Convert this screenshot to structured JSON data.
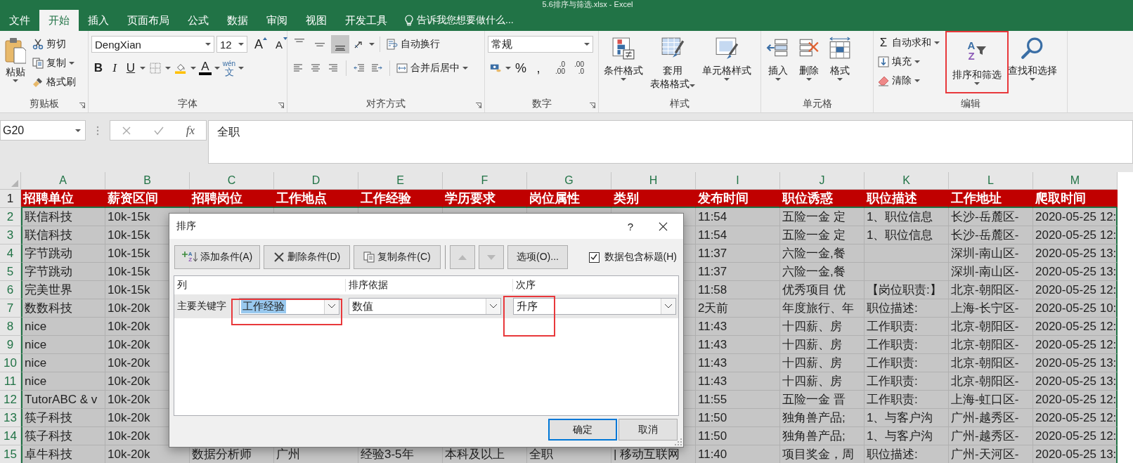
{
  "window": {
    "title": "5.6排序与筛选.xlsx - Excel"
  },
  "tabs": [
    {
      "label": "文件",
      "selected": false
    },
    {
      "label": "开始",
      "selected": true
    },
    {
      "label": "插入",
      "selected": false
    },
    {
      "label": "页面布局",
      "selected": false
    },
    {
      "label": "公式",
      "selected": false
    },
    {
      "label": "数据",
      "selected": false
    },
    {
      "label": "审阅",
      "selected": false
    },
    {
      "label": "视图",
      "selected": false
    },
    {
      "label": "开发工具",
      "selected": false
    }
  ],
  "tell_me": "告诉我您想要做什么...",
  "clipboard": {
    "paste": "粘贴",
    "cut": "剪切",
    "copy": "复制",
    "format_painter": "格式刷",
    "label": "剪贴板"
  },
  "font": {
    "name": "DengXian",
    "size": "12",
    "grow": "A",
    "shrink": "A",
    "bold": "B",
    "italic": "I",
    "underline": "U",
    "font_color": "A",
    "phonetic": [
      "wén",
      "文"
    ],
    "label": "字体"
  },
  "alignment": {
    "vertical": [
      {
        "selected": false
      },
      {
        "selected": false
      },
      {
        "selected": true
      }
    ],
    "wrap": "自动换行",
    "merge": "合并后居中",
    "label": "对齐方式"
  },
  "number": {
    "format": "常规",
    "percent": "%",
    "comma": ",",
    "increase_decimal": [
      ".0",
      ".00"
    ],
    "decrease_decimal": [
      ".00",
      ".0"
    ],
    "label": "数字"
  },
  "styles": {
    "conditional": "条件格式",
    "table": [
      "套用",
      "表格格式"
    ],
    "cell_styles": "单元格样式",
    "label": "样式"
  },
  "cells": {
    "insert": "插入",
    "delete": "删除",
    "format": "格式",
    "label": "单元格"
  },
  "editing": {
    "autosum_symbol": "Σ",
    "autosum": "自动求和",
    "fill": "填充",
    "clear": "清除",
    "sort_letters": [
      "A",
      "Z"
    ],
    "sort_filter": "排序和筛选",
    "sort_annotated": true,
    "find": "查找和选择",
    "label": "编辑"
  },
  "formula_bar": {
    "name_box": "G20",
    "function_label": "fx",
    "formula": "全职"
  },
  "grid": {
    "columns": [
      {
        "letter": "A",
        "selected": true
      },
      {
        "letter": "B",
        "selected": true
      },
      {
        "letter": "C",
        "selected": true
      },
      {
        "letter": "D",
        "selected": true
      },
      {
        "letter": "E",
        "selected": true
      },
      {
        "letter": "F",
        "selected": true
      },
      {
        "letter": "G",
        "selected": true
      },
      {
        "letter": "H",
        "selected": true
      },
      {
        "letter": "I",
        "selected": true
      },
      {
        "letter": "J",
        "selected": true
      },
      {
        "letter": "K",
        "selected": true
      },
      {
        "letter": "L",
        "selected": true
      },
      {
        "letter": "M",
        "selected": true
      }
    ],
    "header": {
      "number": "1",
      "selected": false,
      "cells": [
        "招聘单位",
        "薪资区间",
        "招聘岗位",
        "工作地点",
        "工作经验",
        "学历要求",
        "岗位属性",
        "类别",
        "发布时间",
        "职位诱惑",
        "职位描述",
        "工作地址",
        "爬取时间"
      ]
    },
    "rows": [
      {
        "number": "2",
        "selected": true,
        "left": [
          "联信科技",
          "10k-15k"
        ],
        "right": [
          "11:54",
          "五险一金 定",
          "1、职位信息",
          "长沙-岳麓区-",
          "2020-05-25 12:"
        ]
      },
      {
        "number": "3",
        "selected": true,
        "left": [
          "联信科技",
          "10k-15k"
        ],
        "right": [
          "11:54",
          "五险一金 定",
          "1、职位信息",
          "长沙-岳麓区-",
          "2020-05-25 12:"
        ]
      },
      {
        "number": "4",
        "selected": true,
        "left": [
          "字节跳动",
          "10k-15k"
        ],
        "right": [
          "11:37",
          "六险一金,餐",
          {
            "kind": "blank"
          },
          "深圳-南山区-",
          "2020-05-25 13:"
        ]
      },
      {
        "number": "5",
        "selected": true,
        "left": [
          "字节跳动",
          "10k-15k"
        ],
        "right": [
          "11:37",
          "六险一金,餐",
          {
            "kind": "blank"
          },
          "深圳-南山区-",
          "2020-05-25 13:"
        ]
      },
      {
        "number": "6",
        "selected": true,
        "left": [
          "完美世界",
          "10k-15k"
        ],
        "right": [
          "11:58",
          "优秀项目 优",
          "【岗位职责:】",
          "北京-朝阳区-",
          "2020-05-25 12:"
        ]
      },
      {
        "number": "7",
        "selected": true,
        "left": [
          "数数科技",
          "10k-20k"
        ],
        "right": [
          "2天前",
          "年度旅行、年",
          "职位描述:",
          "上海-长宁区-",
          "2020-05-25 10:"
        ]
      },
      {
        "number": "8",
        "selected": true,
        "left": [
          "nice",
          "10k-20k"
        ],
        "right": [
          "11:43",
          "十四薪、房",
          "工作职责:",
          "北京-朝阳区-",
          "2020-05-25 12:"
        ]
      },
      {
        "number": "9",
        "selected": true,
        "left": [
          "nice",
          "10k-20k"
        ],
        "right": [
          "11:43",
          "十四薪、房",
          "工作职责:",
          "北京-朝阳区-",
          "2020-05-25 12:"
        ]
      },
      {
        "number": "10",
        "selected": true,
        "left": [
          "nice",
          "10k-20k"
        ],
        "right": [
          "11:43",
          "十四薪、房",
          "工作职责:",
          "北京-朝阳区-",
          "2020-05-25 13:"
        ]
      },
      {
        "number": "11",
        "selected": true,
        "left": [
          "nice",
          "10k-20k"
        ],
        "right": [
          "11:43",
          "十四薪、房",
          "工作职责:",
          "北京-朝阳区-",
          "2020-05-25 13:"
        ]
      },
      {
        "number": "12",
        "selected": true,
        "left": [
          "TutorABC & v",
          "10k-20k"
        ],
        "right": [
          "11:55",
          "五险一金 晋",
          "工作职责:",
          "上海-虹口区-",
          "2020-05-25 12:"
        ]
      },
      {
        "number": "13",
        "selected": true,
        "left": [
          "筷子科技",
          "10k-20k"
        ],
        "right": [
          "11:50",
          "独角兽产品;",
          "1、与客户沟",
          "广州-越秀区-",
          "2020-05-25 12:"
        ]
      },
      {
        "number": "14",
        "selected": true,
        "left": [
          "筷子科技",
          "10k-20k"
        ],
        "right": [
          "11:50",
          "独角兽产品;",
          "1、与客户沟",
          "广州-越秀区-",
          "2020-05-25 12:"
        ]
      },
      {
        "number": "15",
        "selected": true,
        "cells": [
          "卓牛科技",
          "10k-20k",
          "数据分析师",
          "广州",
          "经验3-5年",
          "本科及以上",
          "全职",
          "| 移动互联网",
          "11:40",
          "项目奖金，周",
          "职位描述:",
          "广州-天河区-",
          "2020-05-25 13:"
        ]
      }
    ]
  },
  "dialog": {
    "title": "排序",
    "help": "?",
    "add": {
      "label": "添加条件(A)",
      "icon_letters": [
        "A",
        "Z"
      ]
    },
    "delete": "删除条件(D)",
    "copy": "复制条件(C)",
    "move_buttons": [
      {
        "disabled": true
      },
      {
        "disabled": true
      }
    ],
    "options": "选项(O)...",
    "has_headers": {
      "label": "数据包含标题(H)",
      "checked": true
    },
    "columns": [
      "列",
      "排序依据",
      "次序"
    ],
    "levels": [
      {
        "label": "主要关键字",
        "column": "工作经验",
        "column_selected": true,
        "column_annotated": true,
        "sort_on": "数值",
        "order": "升序",
        "order_annotated": true
      }
    ],
    "buttons": [
      {
        "label": "确定",
        "default": true
      },
      {
        "label": "取消",
        "default": false
      }
    ]
  }
}
